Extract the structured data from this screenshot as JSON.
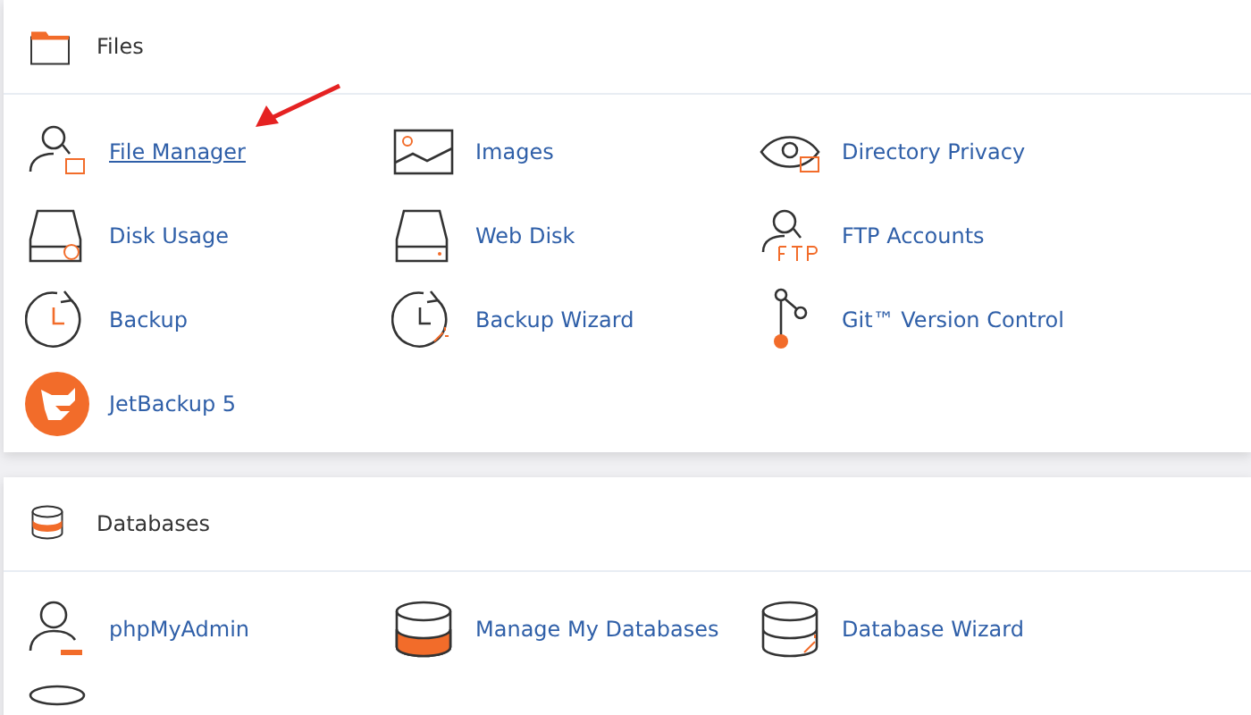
{
  "sections": [
    {
      "title": "Files",
      "items": [
        {
          "label": "File Manager",
          "hovered": true
        },
        {
          "label": "Images",
          "hovered": false
        },
        {
          "label": "Directory Privacy",
          "hovered": false
        },
        {
          "label": "Disk Usage",
          "hovered": false
        },
        {
          "label": "Web Disk",
          "hovered": false
        },
        {
          "label": "FTP Accounts",
          "hovered": false
        },
        {
          "label": "Backup",
          "hovered": false
        },
        {
          "label": "Backup Wizard",
          "hovered": false
        },
        {
          "label": "Git™ Version Control",
          "hovered": false
        },
        {
          "label": "JetBackup 5",
          "hovered": false
        }
      ]
    },
    {
      "title": "Databases",
      "items": [
        {
          "label": "phpMyAdmin",
          "hovered": false
        },
        {
          "label": "Manage My Databases",
          "hovered": false
        },
        {
          "label": "Database Wizard",
          "hovered": false
        }
      ]
    }
  ]
}
